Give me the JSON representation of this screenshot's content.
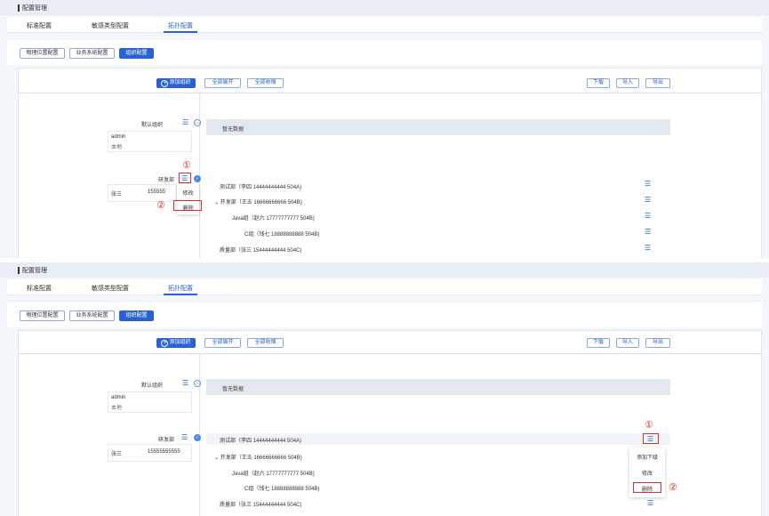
{
  "page": {
    "title": "配置管理"
  },
  "tabs": [
    {
      "label": "标准配置"
    },
    {
      "label": "敏感类型配置"
    },
    {
      "label": "拓扑配置"
    }
  ],
  "subtabs": [
    {
      "label": "物理位置配置"
    },
    {
      "label": "业务系统配置"
    },
    {
      "label": "组织配置"
    }
  ],
  "toolbar": {
    "add_org": "添加组织",
    "expand_all": "全部展开",
    "collapse_all": "全部收缩",
    "download": "下载",
    "import": "导入",
    "export": "导出"
  },
  "orgs": {
    "default": {
      "label": "默认组织",
      "card_name": "admin",
      "card_sub": "本地"
    },
    "rd": {
      "label": "研发部",
      "card_name": "张三",
      "card_phone_short": "155555",
      "card_phone": "15555555555"
    }
  },
  "nodata": "暂无数据",
  "rows": [
    {
      "text": "测试部（李四 14444444444 504A)"
    },
    {
      "text": "⌄ 开发部（王五 16666666666 504B)"
    },
    {
      "text": "Java组（赵六 17777777777 504B)"
    },
    {
      "text": "C组（钱七 18888888888 504B)"
    },
    {
      "text": "质量部（张三 15444444444 504C)"
    }
  ],
  "menu1": {
    "edit": "修改",
    "delete": "删除"
  },
  "menu2": {
    "add_child": "添加下级",
    "edit": "修改",
    "delete": "删除"
  },
  "annotations": {
    "one": "①",
    "two": "②"
  },
  "icons": {
    "list": "☰",
    "collapse": "︿",
    "check": "✓",
    "plus": "+"
  },
  "colors": {
    "primary": "#2a62d6",
    "highlight": "#d8302f"
  }
}
